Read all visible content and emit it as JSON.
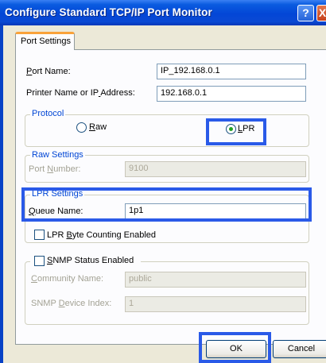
{
  "window": {
    "title": "Configure Standard TCP/IP Port Monitor",
    "help_glyph": "?",
    "close_glyph": "X"
  },
  "tab": {
    "label": "Port Settings"
  },
  "port_name": {
    "label": "Port Name:",
    "value": "IP_192.168.0.1"
  },
  "printer_address": {
    "label": "Printer Name or IP Address:",
    "value": "192.168.0.1"
  },
  "protocol": {
    "legend": "Protocol",
    "raw_label": "Raw",
    "lpr_label": "LPR",
    "selected": "LPR"
  },
  "raw_settings": {
    "legend": "Raw Settings",
    "port_number_label": "Port Number:",
    "port_number_value": "9100"
  },
  "lpr_settings": {
    "legend": "LPR Settings",
    "queue_name_label": "Queue Name:",
    "queue_name_value": "1p1",
    "byte_counting_label": "LPR Byte Counting Enabled",
    "byte_counting_checked": false
  },
  "snmp": {
    "label": "SNMP Status Enabled",
    "checked": false,
    "community_label": "Community Name:",
    "community_value": "public",
    "device_index_label": "SNMP Device Index:",
    "device_index_value": "1"
  },
  "buttons": {
    "ok": "OK",
    "cancel": "Cancel"
  },
  "colors": {
    "highlight": "#2A5AE8",
    "titlebar": "#0346D6",
    "tab_accent": "#F9A23A",
    "legend_text": "#0046D5"
  }
}
